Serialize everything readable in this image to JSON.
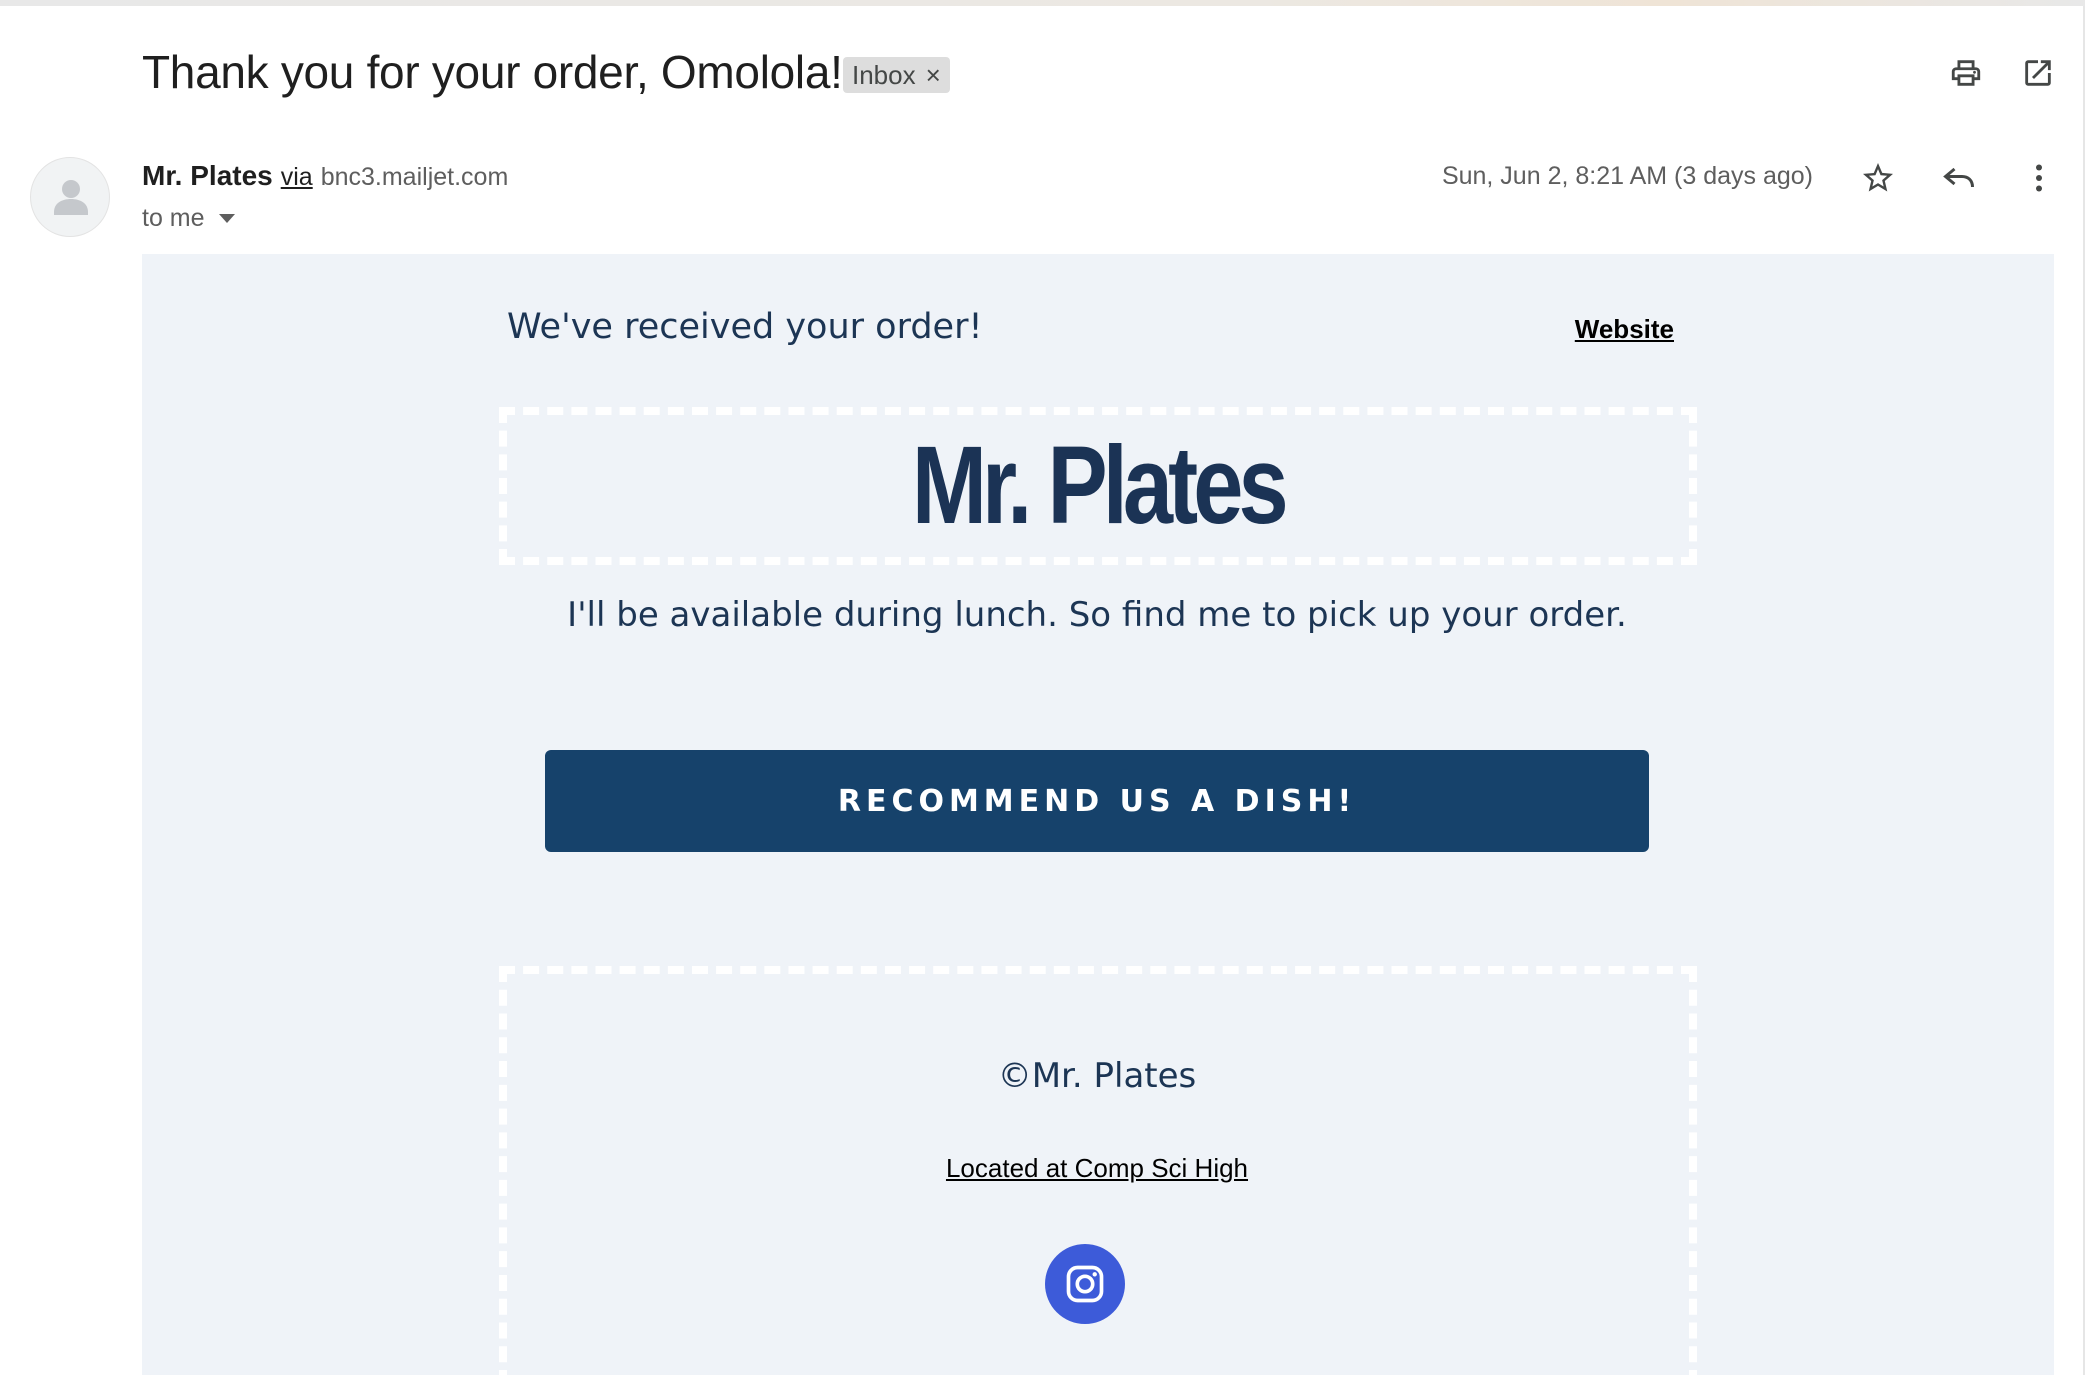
{
  "email": {
    "subject": "Thank you for your order, Omolola!",
    "label_chip": "Inbox",
    "label_remove": "×",
    "sender_name": "Mr. Plates",
    "via": "via",
    "sender_domain": "bnc3.mailjet.com",
    "recipient": "to me",
    "date": "Sun, Jun 2, 8:21 AM (3 days ago)"
  },
  "icons": {
    "print": "print-icon",
    "open_new_window": "open-in-new-window-icon",
    "star": "star-icon",
    "reply": "reply-icon",
    "more": "more-vertical-icon",
    "avatar": "default-avatar-icon",
    "recipient_dropdown": "caret-down-icon",
    "instagram": "instagram-icon"
  },
  "body": {
    "received_heading": "We've received your order!",
    "website_link": "Website",
    "logo_text": "Mr. Plates",
    "availability": "I'll be available during lunch. So find me to pick up your order.",
    "cta_label": "RECOMMEND US A DISH!",
    "copyright": "©Mr. Plates",
    "location_link": "Located at Comp Sci High"
  },
  "colors": {
    "body_background": "#eff3f8",
    "navy_text": "#1c3554",
    "cta_background": "#16426b",
    "instagram_circle": "#3d5bd9"
  }
}
